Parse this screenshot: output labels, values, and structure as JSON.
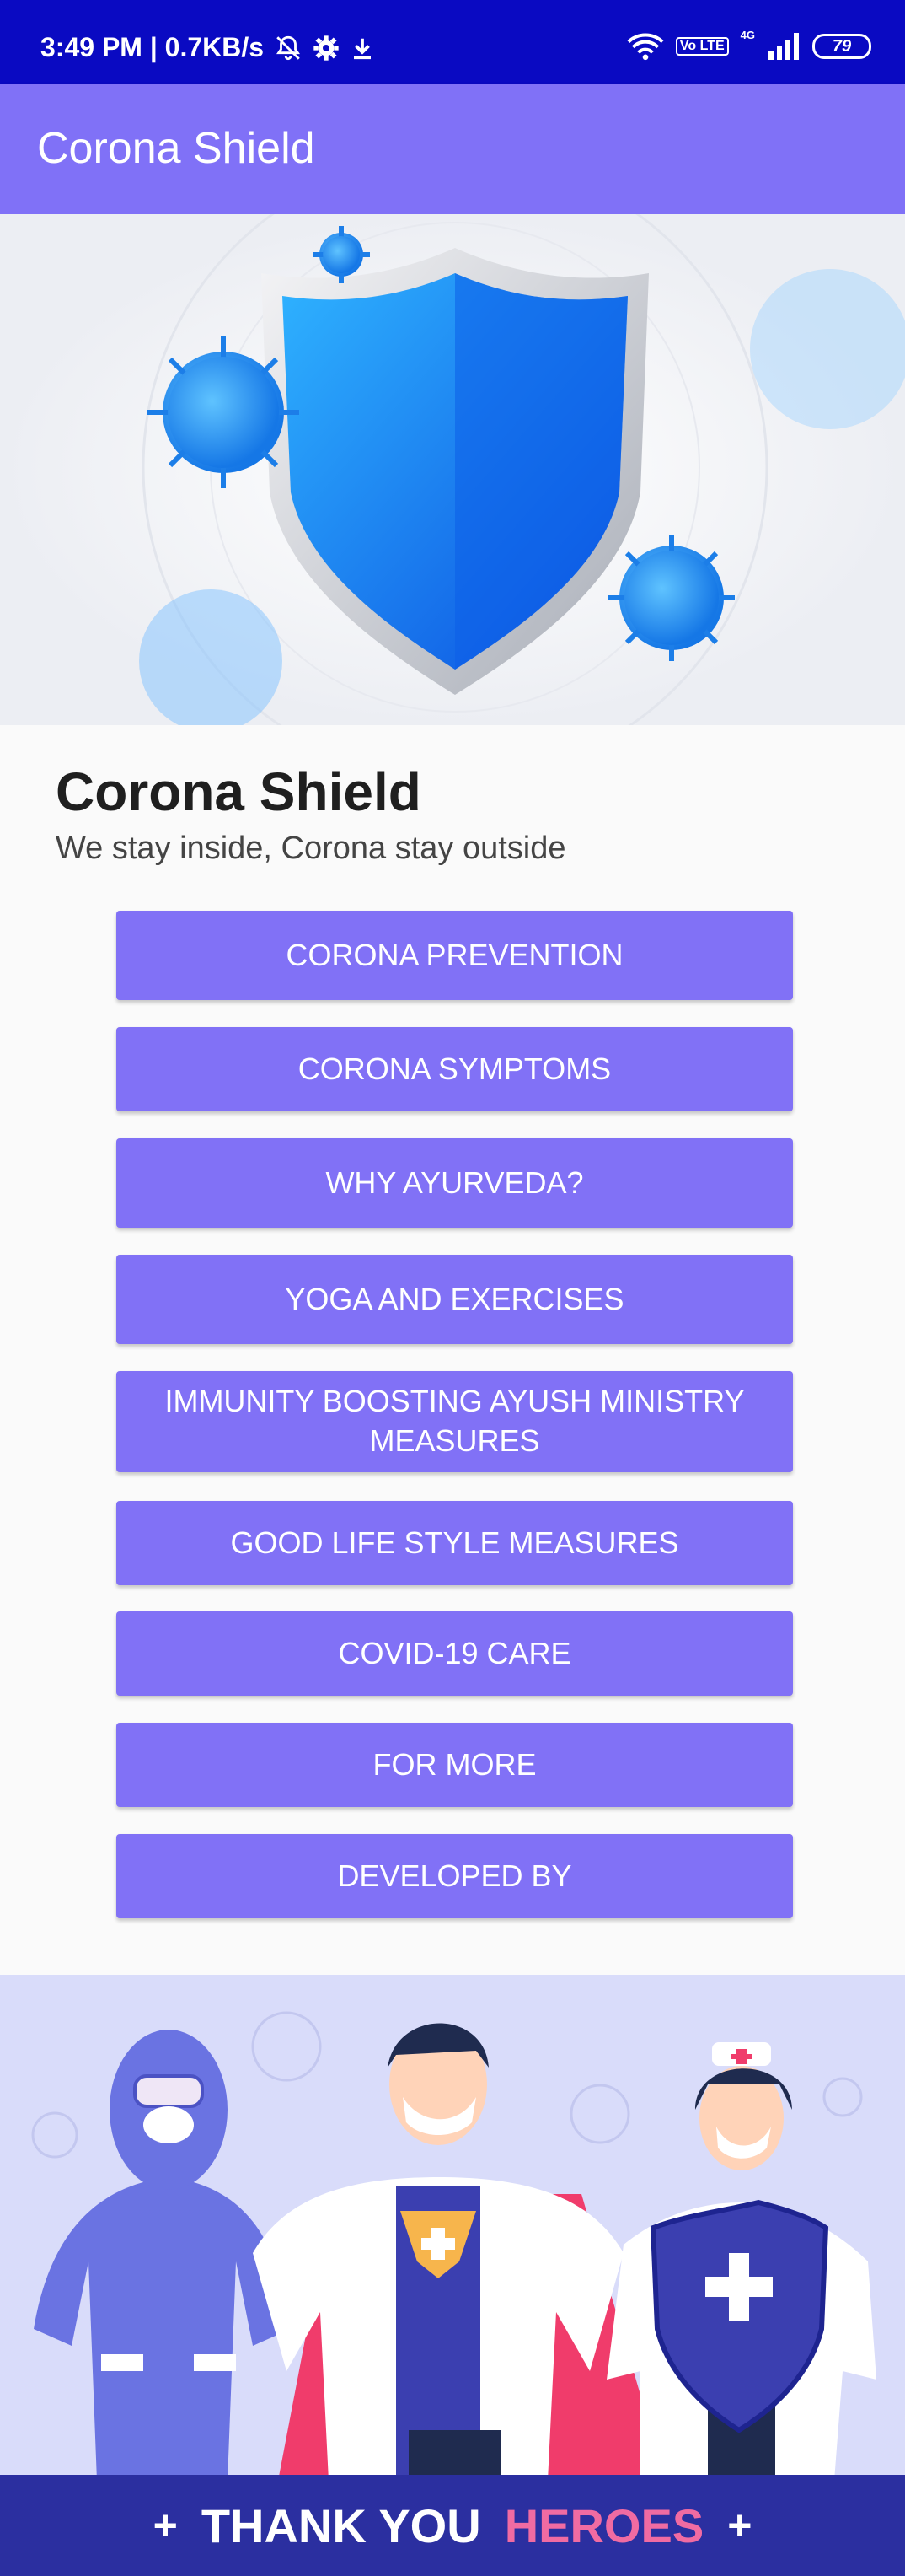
{
  "status_bar": {
    "time_speed": "3:49 PM | 0.7KB/s",
    "network_label": "4G",
    "volte_label": "Vo LTE",
    "battery_level": "79"
  },
  "app_bar": {
    "title": "Corona Shield"
  },
  "hero": {
    "image": "shield-virus-illustration"
  },
  "content": {
    "headline": "Corona Shield",
    "tagline": "We stay inside, Corona stay outside"
  },
  "menu": {
    "items": [
      {
        "label": "CORONA PREVENTION"
      },
      {
        "label": "CORONA SYMPTOMS"
      },
      {
        "label": "WHY AYURVEDA?"
      },
      {
        "label": "YOGA AND EXERCISES"
      },
      {
        "label": "IMMUNITY BOOSTING AYUSH MINISTRY MEASURES"
      },
      {
        "label": "GOOD LIFE STYLE MEASURES"
      },
      {
        "label": "COVID-19 CARE"
      },
      {
        "label": "FOR MORE"
      },
      {
        "label": "DEVELOPED BY"
      }
    ]
  },
  "banner": {
    "thank": "THANK YOU",
    "heroes": "HEROES"
  },
  "colors": {
    "status_bar": "#0a0ac2",
    "primary": "#8071f7",
    "banner_strip": "#2b2fa0",
    "accent_pink": "#f06ba2"
  }
}
